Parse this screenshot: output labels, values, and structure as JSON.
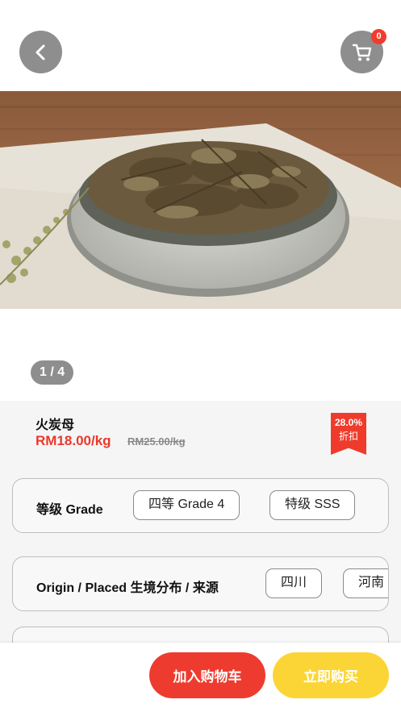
{
  "header": {
    "back_icon": "chevron-left-icon",
    "cart_icon": "cart-icon",
    "cart_count": "0"
  },
  "gallery": {
    "pager": "1 / 4"
  },
  "product": {
    "name": "火炭母",
    "price": "RM18.00/kg",
    "original_price": "RM25.00/kg",
    "discount_percent": "28.0%",
    "discount_label": "折扣"
  },
  "options": {
    "grade": {
      "label": "等级 Grade",
      "choices": [
        "四等 Grade 4",
        "特级 SSS"
      ]
    },
    "origin": {
      "label": "Origin / Placed 生境分布 / 来源",
      "choices": [
        "四川",
        "河南"
      ]
    }
  },
  "actions": {
    "add_to_cart": "加入购物车",
    "buy_now": "立即购买"
  },
  "colors": {
    "accent_red": "#ee3b2f",
    "accent_yellow": "#fbd535",
    "button_gray": "#8e8e8e"
  }
}
